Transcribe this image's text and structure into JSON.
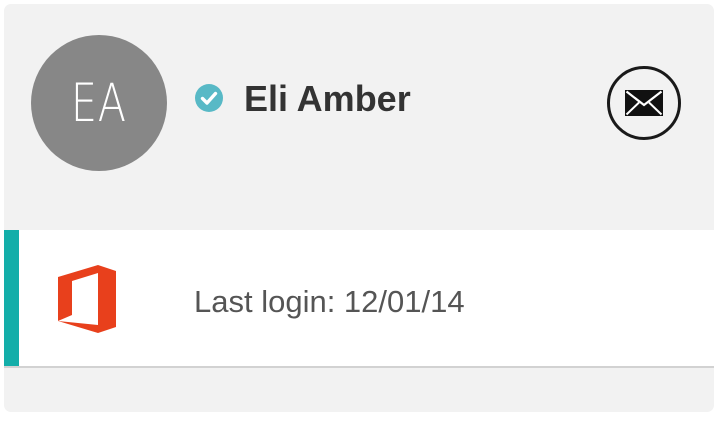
{
  "profile": {
    "initials": "EA",
    "name": "Eli Amber",
    "verified": true
  },
  "session": {
    "last_login": "Last login: 12/01/14",
    "app_icon": "office-icon"
  },
  "icons": {
    "verified": "check-circle-icon",
    "mail": "envelope-icon"
  },
  "colors": {
    "accent": "#13aea9",
    "verified_badge": "#58b9c6",
    "office_brand": "#e8401c",
    "avatar_bg": "#878787"
  }
}
